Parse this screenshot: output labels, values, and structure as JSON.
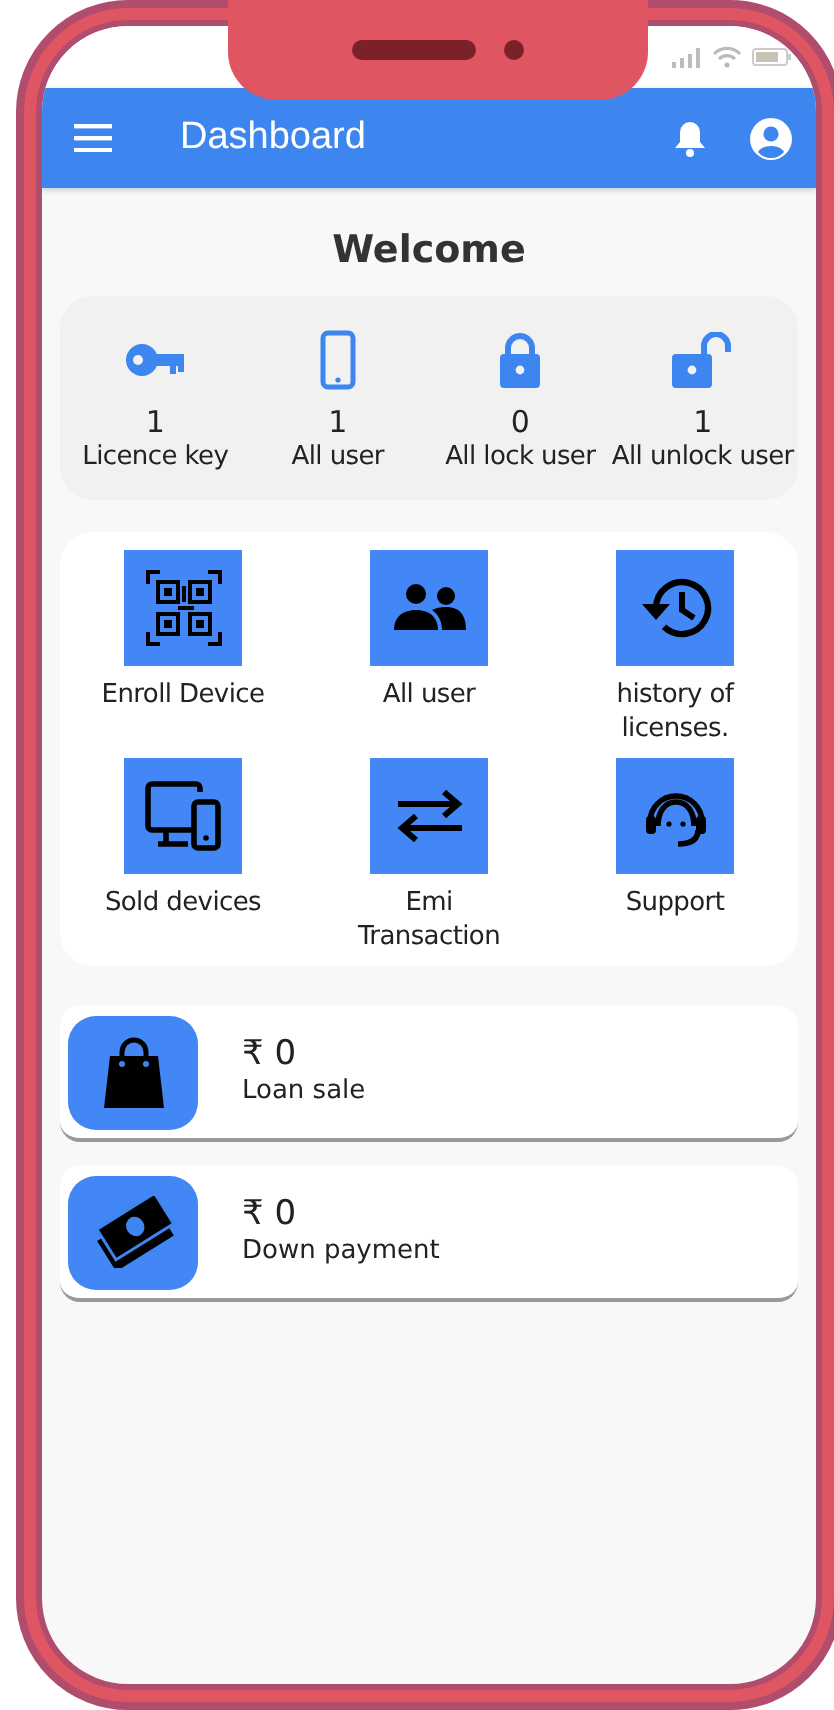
{
  "app_bar": {
    "title": "Dashboard"
  },
  "heading": "Welcome",
  "stats": [
    {
      "kind": "key",
      "value": "1",
      "label": "Licence key"
    },
    {
      "kind": "phone",
      "value": "1",
      "label": "All user"
    },
    {
      "kind": "lock",
      "value": "0",
      "label": "All lock user"
    },
    {
      "kind": "unlock",
      "value": "1",
      "label": "All unlock user"
    }
  ],
  "actions": [
    {
      "kind": "qr",
      "label": "Enroll Device"
    },
    {
      "kind": "users",
      "label": "All user"
    },
    {
      "kind": "history",
      "label": "history of licenses."
    },
    {
      "kind": "devices",
      "label": "Sold devices"
    },
    {
      "kind": "transfer",
      "label": "Emi Transaction"
    },
    {
      "kind": "support",
      "label": "Support"
    }
  ],
  "summaries": [
    {
      "kind": "bag",
      "amount": "₹ 0",
      "label": "Loan sale"
    },
    {
      "kind": "cash",
      "amount": "₹ 0",
      "label": "Down payment"
    }
  ]
}
